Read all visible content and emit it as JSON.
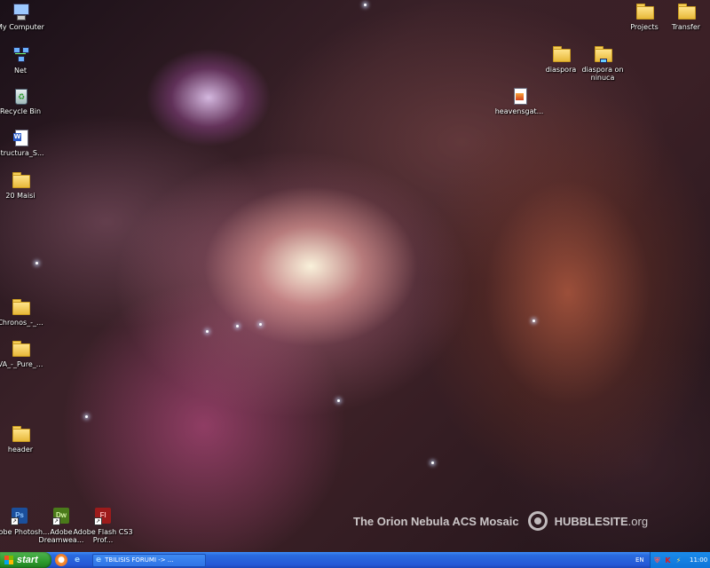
{
  "desktop": {
    "left_icons": [
      {
        "label": "My Computer",
        "icon": "my-computer-icon"
      },
      {
        "label": "Net",
        "icon": "network-icon"
      },
      {
        "label": "Recycle Bin",
        "icon": "recycle-bin-icon"
      },
      {
        "label": "structura_S...",
        "icon": "word-document-icon"
      },
      {
        "label": "20 Maisi",
        "icon": "folder-icon"
      },
      {
        "label": "Chronos_-_...",
        "icon": "folder-icon"
      },
      {
        "label": "VA_-_Pure_...",
        "icon": "folder-icon"
      },
      {
        "label": "header",
        "icon": "folder-icon"
      }
    ],
    "right_icons": [
      {
        "label": "Projects",
        "icon": "folder-icon"
      },
      {
        "label": "Transfer",
        "icon": "folder-icon"
      },
      {
        "label": "diaspora",
        "icon": "folder-icon"
      },
      {
        "label": "diaspora on ninuca",
        "icon": "network-folder-icon"
      },
      {
        "label": "heavensgat...",
        "icon": "file-icon"
      }
    ],
    "app_shortcuts": [
      {
        "label": "Adobe Photosh...",
        "badge": "Ps",
        "color": "#1b4f9c"
      },
      {
        "label": "Adobe Dreamwea...",
        "badge": "Dw",
        "color": "#4a7a1a"
      },
      {
        "label": "Adobe Flash CS3 Prof...",
        "badge": "Fl",
        "color": "#9c1b1b"
      }
    ],
    "watermark": {
      "title": "The Orion Nebula ACS Mosaic",
      "brand": "HUBBLESITE",
      "brand_suffix": ".org"
    }
  },
  "taskbar": {
    "start_label": "start",
    "quick_launch": [
      "firefox-icon",
      "internet-explorer-icon"
    ],
    "open_window": "TBILISIS FORUMI -> ...",
    "language": "EN",
    "tray_icons": [
      "shield-icon",
      "kaspersky-icon",
      "network-tray-icon"
    ],
    "clock": "11:00",
    "accent_color": "#2459d6",
    "start_color": "#2e9b2e"
  }
}
